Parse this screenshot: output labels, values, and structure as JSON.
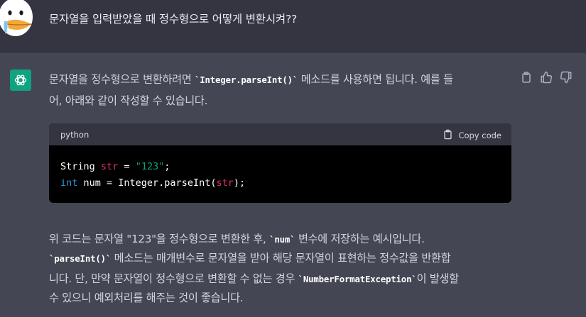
{
  "user_message": "문자열을 입력받았을 때 정수형으로 어떻게 변환시켜??",
  "response": {
    "intro_line1_a": "문자열을 정수형으로 변환하려면 ",
    "intro_line1_code": "`Integer.parseInt()`",
    "intro_line1_b": " 메소드를 사용하면 됩니다. 예를 들",
    "intro_line2": "어, 아래와 같이 작성할 수 있습니다.",
    "code": {
      "language": "python",
      "copy_label": "Copy code",
      "line1": {
        "type": "String",
        "var": "str",
        "eq": " = ",
        "value": "\"123\"",
        "end": ";"
      },
      "line2": {
        "type": "int",
        "rest1": " num = Integer.parseInt(",
        "arg": "str",
        "end": ");"
      }
    },
    "para_l1_a": "위 코드는 문자열 \"123\"을 정수형으로 변환한 후, ",
    "para_l1_code": "`num`",
    "para_l1_b": " 변수에 저장하는 예시입니다.",
    "para_l2_code": "`parseInt()`",
    "para_l2_b": " 메소드는 매개변수로 문자열을 받아 해당 문자열이 표현하는 정수값을 반환합",
    "para_l3_a": "니다. 단, 만약 문자열이 정수형으로 변환할 수 없는 경우 ",
    "para_l3_code": "`NumberFormatException`",
    "para_l3_b": "이 발생할",
    "para_l4": "수 있으니 예외처리를 해주는 것이 좋습니다."
  },
  "icons": {
    "user_avatar": "duck-avatar-icon",
    "bot_avatar": "openai-logo-icon",
    "copy": "clipboard-icon",
    "thumbs_up": "thumbs-up-icon",
    "thumbs_down": "thumbs-down-icon"
  },
  "colors": {
    "page_bg": "#444654",
    "user_row_bg": "#343541",
    "bot_avatar_bg": "#10a37f",
    "code_bg": "#000000",
    "keyword": "#2e95d3",
    "variable": "#df3079",
    "string": "#00a67d"
  }
}
